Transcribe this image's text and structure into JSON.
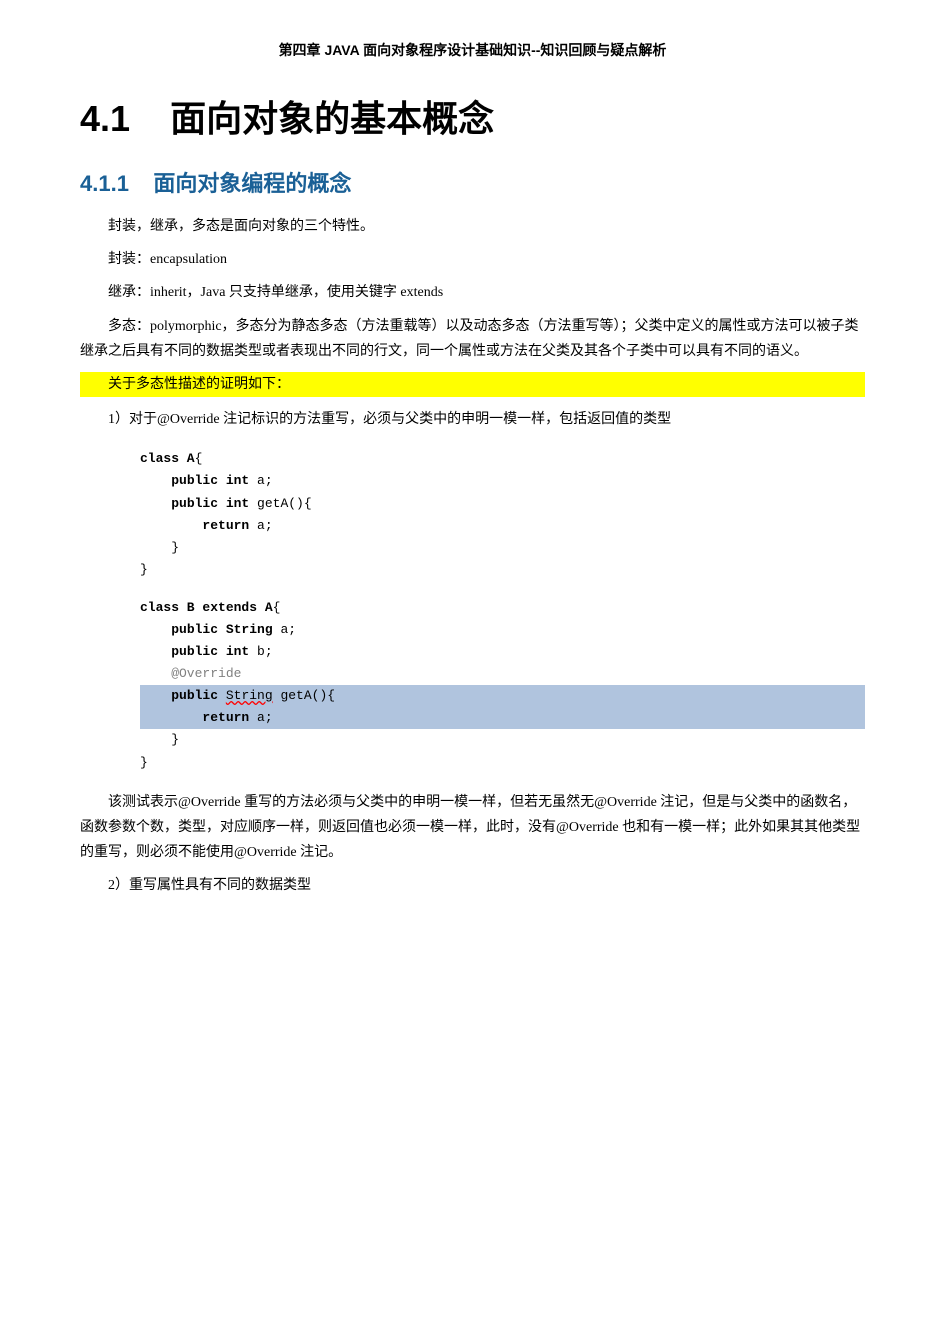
{
  "header": {
    "text": "第四章   JAVA  面向对象程序设计基础知识--知识回顾与疑点解析"
  },
  "chapter": {
    "number": "4.1",
    "title": "面向对象的基本概念"
  },
  "section411": {
    "number": "4.1.1",
    "title": "面向对象编程的概念"
  },
  "content": {
    "line1": "封装，继承，多态是面向对象的三个特性。",
    "line2": "封装：encapsulation",
    "line3": "继承：inherit，Java 只支持单继承，使用关键字 extends",
    "line4": "多态：polymorphic，多态分为静态多态（方法重载等）以及动态多态（方法重写等）；父类中定义的属性或方法可以被子类继承之后具有不同的数据类型或者表现出不同的行文，同一个属性或方法在父类及其各个子类中可以具有不同的语义。",
    "highlighted": "关于多态性描述的证明如下：",
    "item1": "1）对于@Override 注记标识的方法重写，必须与父类中的申明一模一样，包括返回值的类型",
    "code_block_1": {
      "lines": [
        {
          "text": "class A{",
          "type": "normal"
        },
        {
          "text": "    public int a;",
          "type": "normal"
        },
        {
          "text": "    public int getA(){",
          "type": "normal"
        },
        {
          "text": "        return a;",
          "type": "normal"
        },
        {
          "text": "    }",
          "type": "normal"
        },
        {
          "text": "}",
          "type": "normal"
        }
      ]
    },
    "code_block_2": {
      "lines": [
        {
          "text": "class B extends A{",
          "type": "normal"
        },
        {
          "text": "",
          "type": "normal"
        },
        {
          "text": "    public String a;",
          "type": "normal"
        },
        {
          "text": "    public int b;",
          "type": "normal"
        },
        {
          "text": "    @Override",
          "type": "annotation"
        },
        {
          "text": "    public String getA(){",
          "type": "highlighted"
        },
        {
          "text": "        return a;",
          "type": "highlighted"
        },
        {
          "text": "    }",
          "type": "normal"
        },
        {
          "text": "}",
          "type": "normal"
        }
      ]
    },
    "explanation": "该测试表示@Override 重写的方法必须与父类中的申明一模一样，但若无虽然无@Override 注记，但是与父类中的函数名，函数参数个数，类型，对应顺序一样，则返回值也必须一模一样，此时，没有@Override 也和有一模一样；此外如果其其他类型的重写，则必须不能使用@Override 注记。",
    "item2": "2）重写属性具有不同的数据类型"
  }
}
